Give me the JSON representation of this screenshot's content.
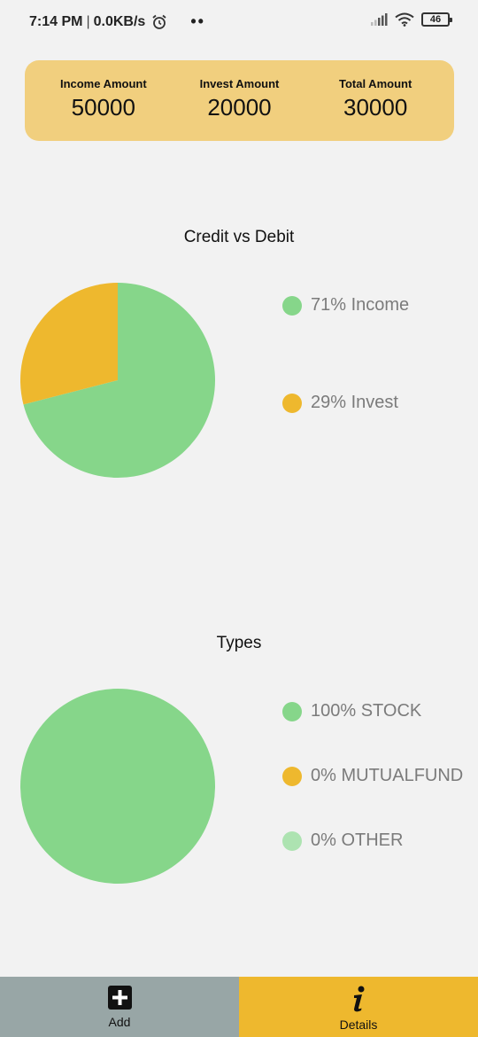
{
  "status_bar": {
    "time": "7:14 PM",
    "separator": "|",
    "speed": "0.0KB/s",
    "dots": "••",
    "battery": "46"
  },
  "summary": {
    "income_label": "Income Amount",
    "income_value": "50000",
    "invest_label": "Invest Amount",
    "invest_value": "20000",
    "total_label": "Total Amount",
    "total_value": "30000"
  },
  "colors": {
    "green": "#86d68a",
    "yellow": "#eeb82e",
    "light_green": "#ade3b1",
    "card": "#f1cf7e"
  },
  "chart_data": [
    {
      "type": "pie",
      "title": "Credit vs Debit",
      "series": [
        {
          "name": "Income",
          "label": "71% Income",
          "value": 71,
          "color": "#86d68a"
        },
        {
          "name": "Invest",
          "label": "29% Invest",
          "value": 29,
          "color": "#eeb82e"
        }
      ]
    },
    {
      "type": "pie",
      "title": "Types",
      "series": [
        {
          "name": "STOCK",
          "label": "100% STOCK",
          "value": 100,
          "color": "#86d68a"
        },
        {
          "name": "MUTUALFUND",
          "label": "0% MUTUALFUND",
          "value": 0,
          "color": "#eeb82e"
        },
        {
          "name": "OTHER",
          "label": "0% OTHER",
          "value": 0,
          "color": "#ade3b1"
        }
      ]
    }
  ],
  "nav": {
    "add_label": "Add",
    "add_icon": "plus-square-icon",
    "details_label": "Details",
    "details_icon": "info-icon"
  }
}
